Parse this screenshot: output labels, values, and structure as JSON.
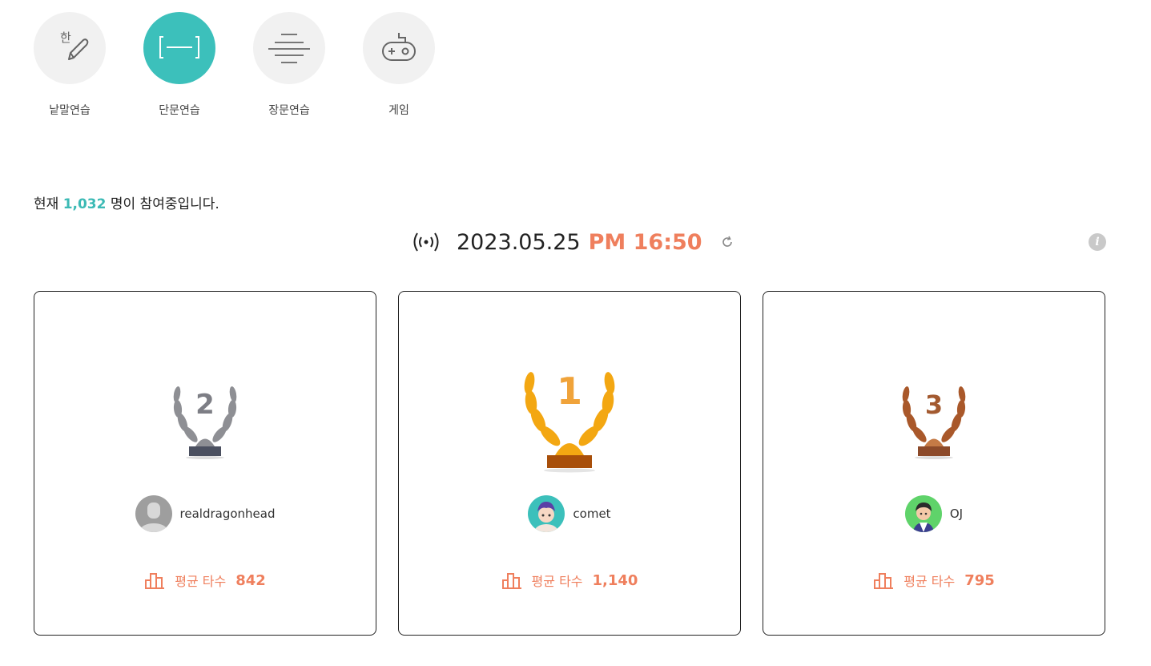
{
  "modes": [
    {
      "label": "낱말연습",
      "icon": "hangul-pencil-icon",
      "icon_char": "한",
      "active": false
    },
    {
      "label": "단문연습",
      "icon": "short-text-icon",
      "active": true
    },
    {
      "label": "장문연습",
      "icon": "long-text-icon",
      "active": false
    },
    {
      "label": "게임",
      "icon": "gamepad-icon",
      "active": false
    }
  ],
  "participants": {
    "prefix": "현재",
    "count": "1,032",
    "suffix": "명이 참여중입니다."
  },
  "timebar": {
    "date": "2023.05.25",
    "time": "PM 16:50",
    "live_icon": "live-broadcast-icon",
    "info_char": "i"
  },
  "ranking": [
    {
      "rank": "2",
      "username": "realdragonhead",
      "score_label": "평균 타수",
      "score": "842",
      "medal_color": "#8e8f94"
    },
    {
      "rank": "1",
      "username": "comet",
      "score_label": "평균 타수",
      "score": "1,140",
      "medal_color": "#f3a712"
    },
    {
      "rank": "3",
      "username": "OJ",
      "score_label": "평균 타수",
      "score": "795",
      "medal_color": "#a9582a"
    }
  ],
  "colors": {
    "accent_teal": "#3cc0bb",
    "accent_orange": "#ef7f5d"
  }
}
